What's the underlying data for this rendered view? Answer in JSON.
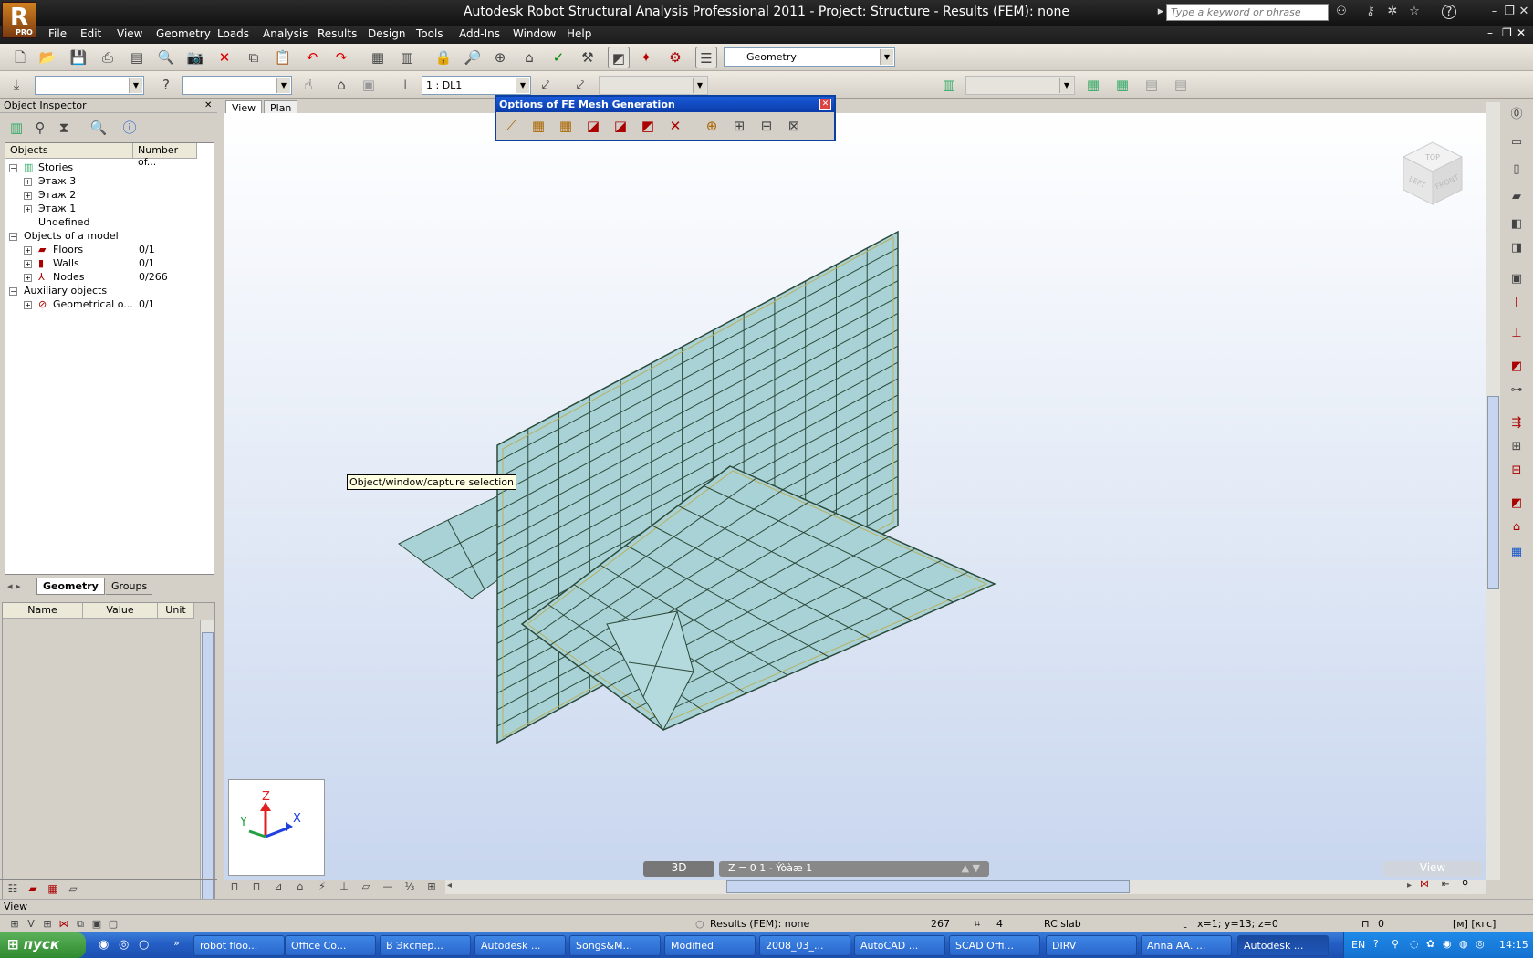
{
  "window": {
    "title": "Autodesk Robot Structural Analysis Professional 2011 - Project: Structure - Results (FEM): none",
    "logo_text": "R",
    "logo_sub": "PRO",
    "search_placeholder": "Type a keyword or phrase"
  },
  "menu": [
    "File",
    "Edit",
    "View",
    "Geometry",
    "Loads",
    "Analysis",
    "Results",
    "Design",
    "Tools",
    "Add-Ins",
    "Window",
    "Help"
  ],
  "toolbar": {
    "layout_combo": "Geometry",
    "case_combo": "1 : DL1"
  },
  "object_inspector": {
    "title": "Object Inspector",
    "col_objects": "Objects",
    "col_number": "Number of...",
    "tree": [
      {
        "label": "Stories",
        "count": "",
        "indent": 0,
        "toggle": "−"
      },
      {
        "label": "Этаж 3",
        "count": "",
        "indent": 1,
        "toggle": "+"
      },
      {
        "label": "Этаж 2",
        "count": "",
        "indent": 1,
        "toggle": "+"
      },
      {
        "label": "Этаж 1",
        "count": "",
        "indent": 1,
        "toggle": "+"
      },
      {
        "label": "Undefined",
        "count": "",
        "indent": 1,
        "toggle": ""
      },
      {
        "label": "Objects of a model",
        "count": "",
        "indent": 0,
        "toggle": "−"
      },
      {
        "label": "Floors",
        "count": "0/1",
        "indent": 1,
        "toggle": "+"
      },
      {
        "label": "Walls",
        "count": "0/1",
        "indent": 1,
        "toggle": "+"
      },
      {
        "label": "Nodes",
        "count": "0/266",
        "indent": 1,
        "toggle": "+"
      },
      {
        "label": "Auxiliary objects",
        "count": "",
        "indent": 0,
        "toggle": "−"
      },
      {
        "label": "Geometrical o...",
        "count": "0/1",
        "indent": 1,
        "toggle": "+"
      }
    ],
    "tab_geometry": "Geometry",
    "tab_groups": "Groups",
    "prop_name": "Name",
    "prop_value": "Value",
    "prop_unit": "Unit"
  },
  "view_tabs": {
    "view": "View",
    "plan": "Plan"
  },
  "fe_options": {
    "title": "Options of FE Mesh Generation"
  },
  "tooltip": "Object/window/capture selection",
  "viewport": {
    "btn_3d": "3D",
    "z_level": "Z = 0 1  - Ýòàæ 1",
    "cube_top": "TOP",
    "cube_left": "LEFT",
    "cube_front": "FRONT",
    "axis_x": "X",
    "axis_y": "Y",
    "axis_z": "Z",
    "view_ghost": "View"
  },
  "status": {
    "left": "View",
    "results": "Results (FEM): none",
    "num1": "267",
    "num2": "4",
    "section": "RC slab",
    "coords": "x=1; y=13; z=0",
    "zero": "0",
    "units": "[м] [кгс] [град.]"
  },
  "taskbar": {
    "start": "пуск",
    "tasks": [
      "robot floo...",
      "Office Co...",
      "В Экспер...",
      "Autodesk ...",
      "Songs&M...",
      "Modified",
      "2008_03_...",
      "AutoCAD ...",
      "SCAD Offi...",
      "DIRV",
      "Anna AA. ...",
      "Autodesk ..."
    ],
    "lang": "EN",
    "time": "14:15"
  },
  "colors": {
    "accent": "#0a3ca8",
    "mesh_fill": "#a9d2d6",
    "mesh_line": "#2c4a3a"
  }
}
